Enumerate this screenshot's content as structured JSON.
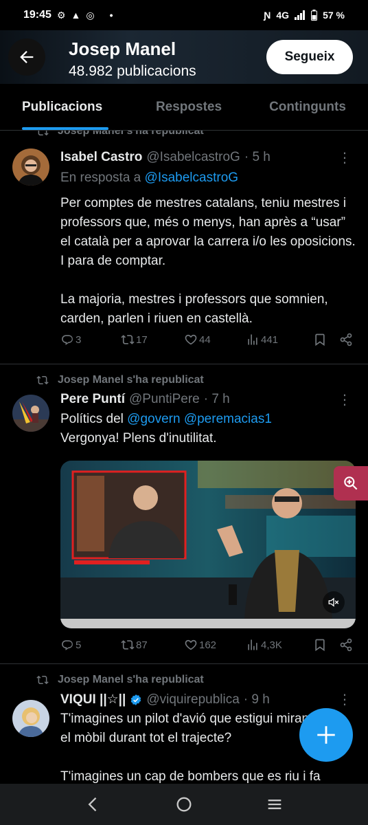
{
  "status": {
    "time": "19:45",
    "network": "4G",
    "battery": "57 %"
  },
  "header": {
    "name": "Josep Manel",
    "count": "48.982 publicacions",
    "follow_label": "Segueix"
  },
  "tabs": [
    {
      "label": "Publicacions",
      "active": true
    },
    {
      "label": "Respostes",
      "active": false
    },
    {
      "label": "Contingunts",
      "active": false
    }
  ],
  "posts": [
    {
      "repost_text": "Josep Manel s'ha republicat",
      "name": "Isabel Castro",
      "handle": "@IsabelcastroG",
      "time": "· 5 h",
      "reply_prefix": "En resposta a",
      "reply_to": "@IsabelcastroG",
      "paragraph1": "Per comptes de mestres catalans, teniu mestres i professors que, més o menys, han après a “usar” el català per a aprovar la carrera i/o les oposicions. I para de comptar.",
      "paragraph2": "La majoria, mestres i professors que somnien, carden, parlen i riuen en castellà.",
      "replies": "3",
      "reposts": "17",
      "likes": "44",
      "views": "441"
    },
    {
      "repost_text": "Josep Manel s'ha republicat",
      "name": "Pere Puntí",
      "handle": "@PuntiPere",
      "time": "· 7 h",
      "text_prefix": "Polítics del",
      "mention1": "@govern",
      "mention2": "@peremacias1",
      "text_line2": "Vergonya! Plens d'inutilitat.",
      "replies": "5",
      "reposts": "87",
      "likes": "162",
      "views": "4,3K"
    },
    {
      "repost_text": "Josep Manel s'ha republicat",
      "name": "VIQUI ||☆||",
      "handle": "@viquirepublica",
      "time": "· 9 h",
      "line1": "T'imagines un pilot d'avió que estigui mirant",
      "line2": "el mòbil durant tot el trajecte?",
      "line3": "T'imagines un cap de bombers que es riu i fa"
    }
  ],
  "colors": {
    "accent": "#1d9bf0",
    "background": "#000000",
    "muted": "#71767b",
    "text": "#e7e9ea"
  }
}
